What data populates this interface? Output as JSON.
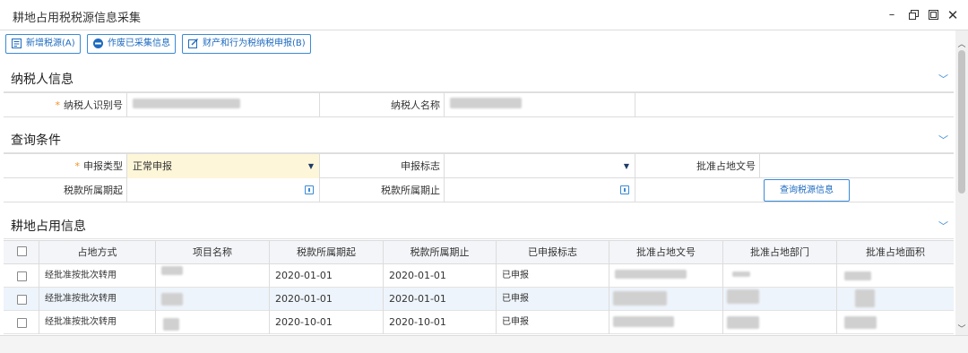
{
  "window": {
    "title": "耕地占用税税源信息采集",
    "controls": [
      "minimize-icon",
      "restore-icon",
      "maximize-icon",
      "close-icon"
    ]
  },
  "toolbar": {
    "add_label": "新增税源(A)",
    "void_label": "作废已采集信息",
    "report_label": "财产和行为税纳税申报(B)"
  },
  "taxpayer": {
    "title": "纳税人信息",
    "id_label": "纳税人识别号",
    "name_label": "纳税人名称"
  },
  "query": {
    "title": "查询条件",
    "decl_type_label": "申报类型",
    "decl_type_value": "正常申报",
    "decl_flag_label": "申报标志",
    "decl_flag_value": "",
    "approval_no_label": "批准占地文号",
    "approval_no_value": "",
    "period_start_label": "税款所属期起",
    "period_start_value": "",
    "period_end_label": "税款所属期止",
    "period_end_value": "",
    "search_button": "查询税源信息"
  },
  "occupancy": {
    "title": "耕地占用信息",
    "columns": [
      "占地方式",
      "项目名称",
      "税款所属期起",
      "税款所属期止",
      "已申报标志",
      "批准占地文号",
      "批准占地部门",
      "批准占地面积"
    ],
    "rows": [
      {
        "method": "经批准按批次转用",
        "start": "2020-01-01",
        "end": "2020-01-01",
        "flag": "已申报"
      },
      {
        "method": "经批准按批次转用",
        "start": "2020-01-01",
        "end": "2020-01-01",
        "flag": "已申报"
      },
      {
        "method": "经批准按批次转用",
        "start": "2020-10-01",
        "end": "2020-10-01",
        "flag": "已申报"
      }
    ]
  },
  "colors": {
    "accent": "#3a8ad6",
    "required": "#f29120",
    "highlight_field": "#fdf6d8",
    "alt_row": "#eef4fb"
  }
}
